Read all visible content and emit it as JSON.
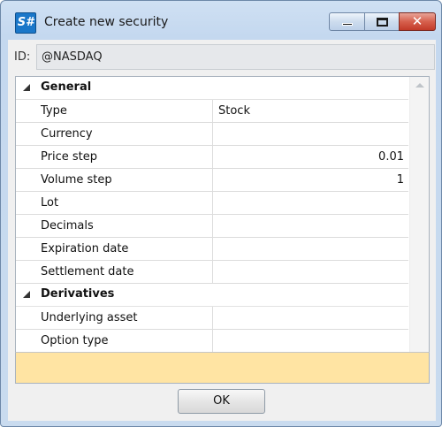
{
  "window": {
    "title": "Create new security",
    "app_icon_text": "S#",
    "close_glyph": "✕"
  },
  "id_field": {
    "label": "ID:",
    "value": "@NASDAQ"
  },
  "grid": {
    "categories": [
      {
        "label": "General",
        "rows": [
          {
            "name": "Type",
            "value": "Stock"
          },
          {
            "name": "Currency",
            "value": ""
          },
          {
            "name": "Price step",
            "value": "0.01"
          },
          {
            "name": "Volume step",
            "value": "1"
          },
          {
            "name": "Lot",
            "value": ""
          },
          {
            "name": "Decimals",
            "value": ""
          },
          {
            "name": "Expiration date",
            "value": ""
          },
          {
            "name": "Settlement date",
            "value": ""
          }
        ]
      },
      {
        "label": "Derivatives",
        "rows": [
          {
            "name": "Underlying asset",
            "value": ""
          },
          {
            "name": "Option type",
            "value": ""
          }
        ]
      }
    ]
  },
  "footer": {
    "ok_label": "OK"
  },
  "colors": {
    "description_panel": "#ffe4a3",
    "close_button": "#d6604d",
    "app_icon": "#1a77c9"
  }
}
